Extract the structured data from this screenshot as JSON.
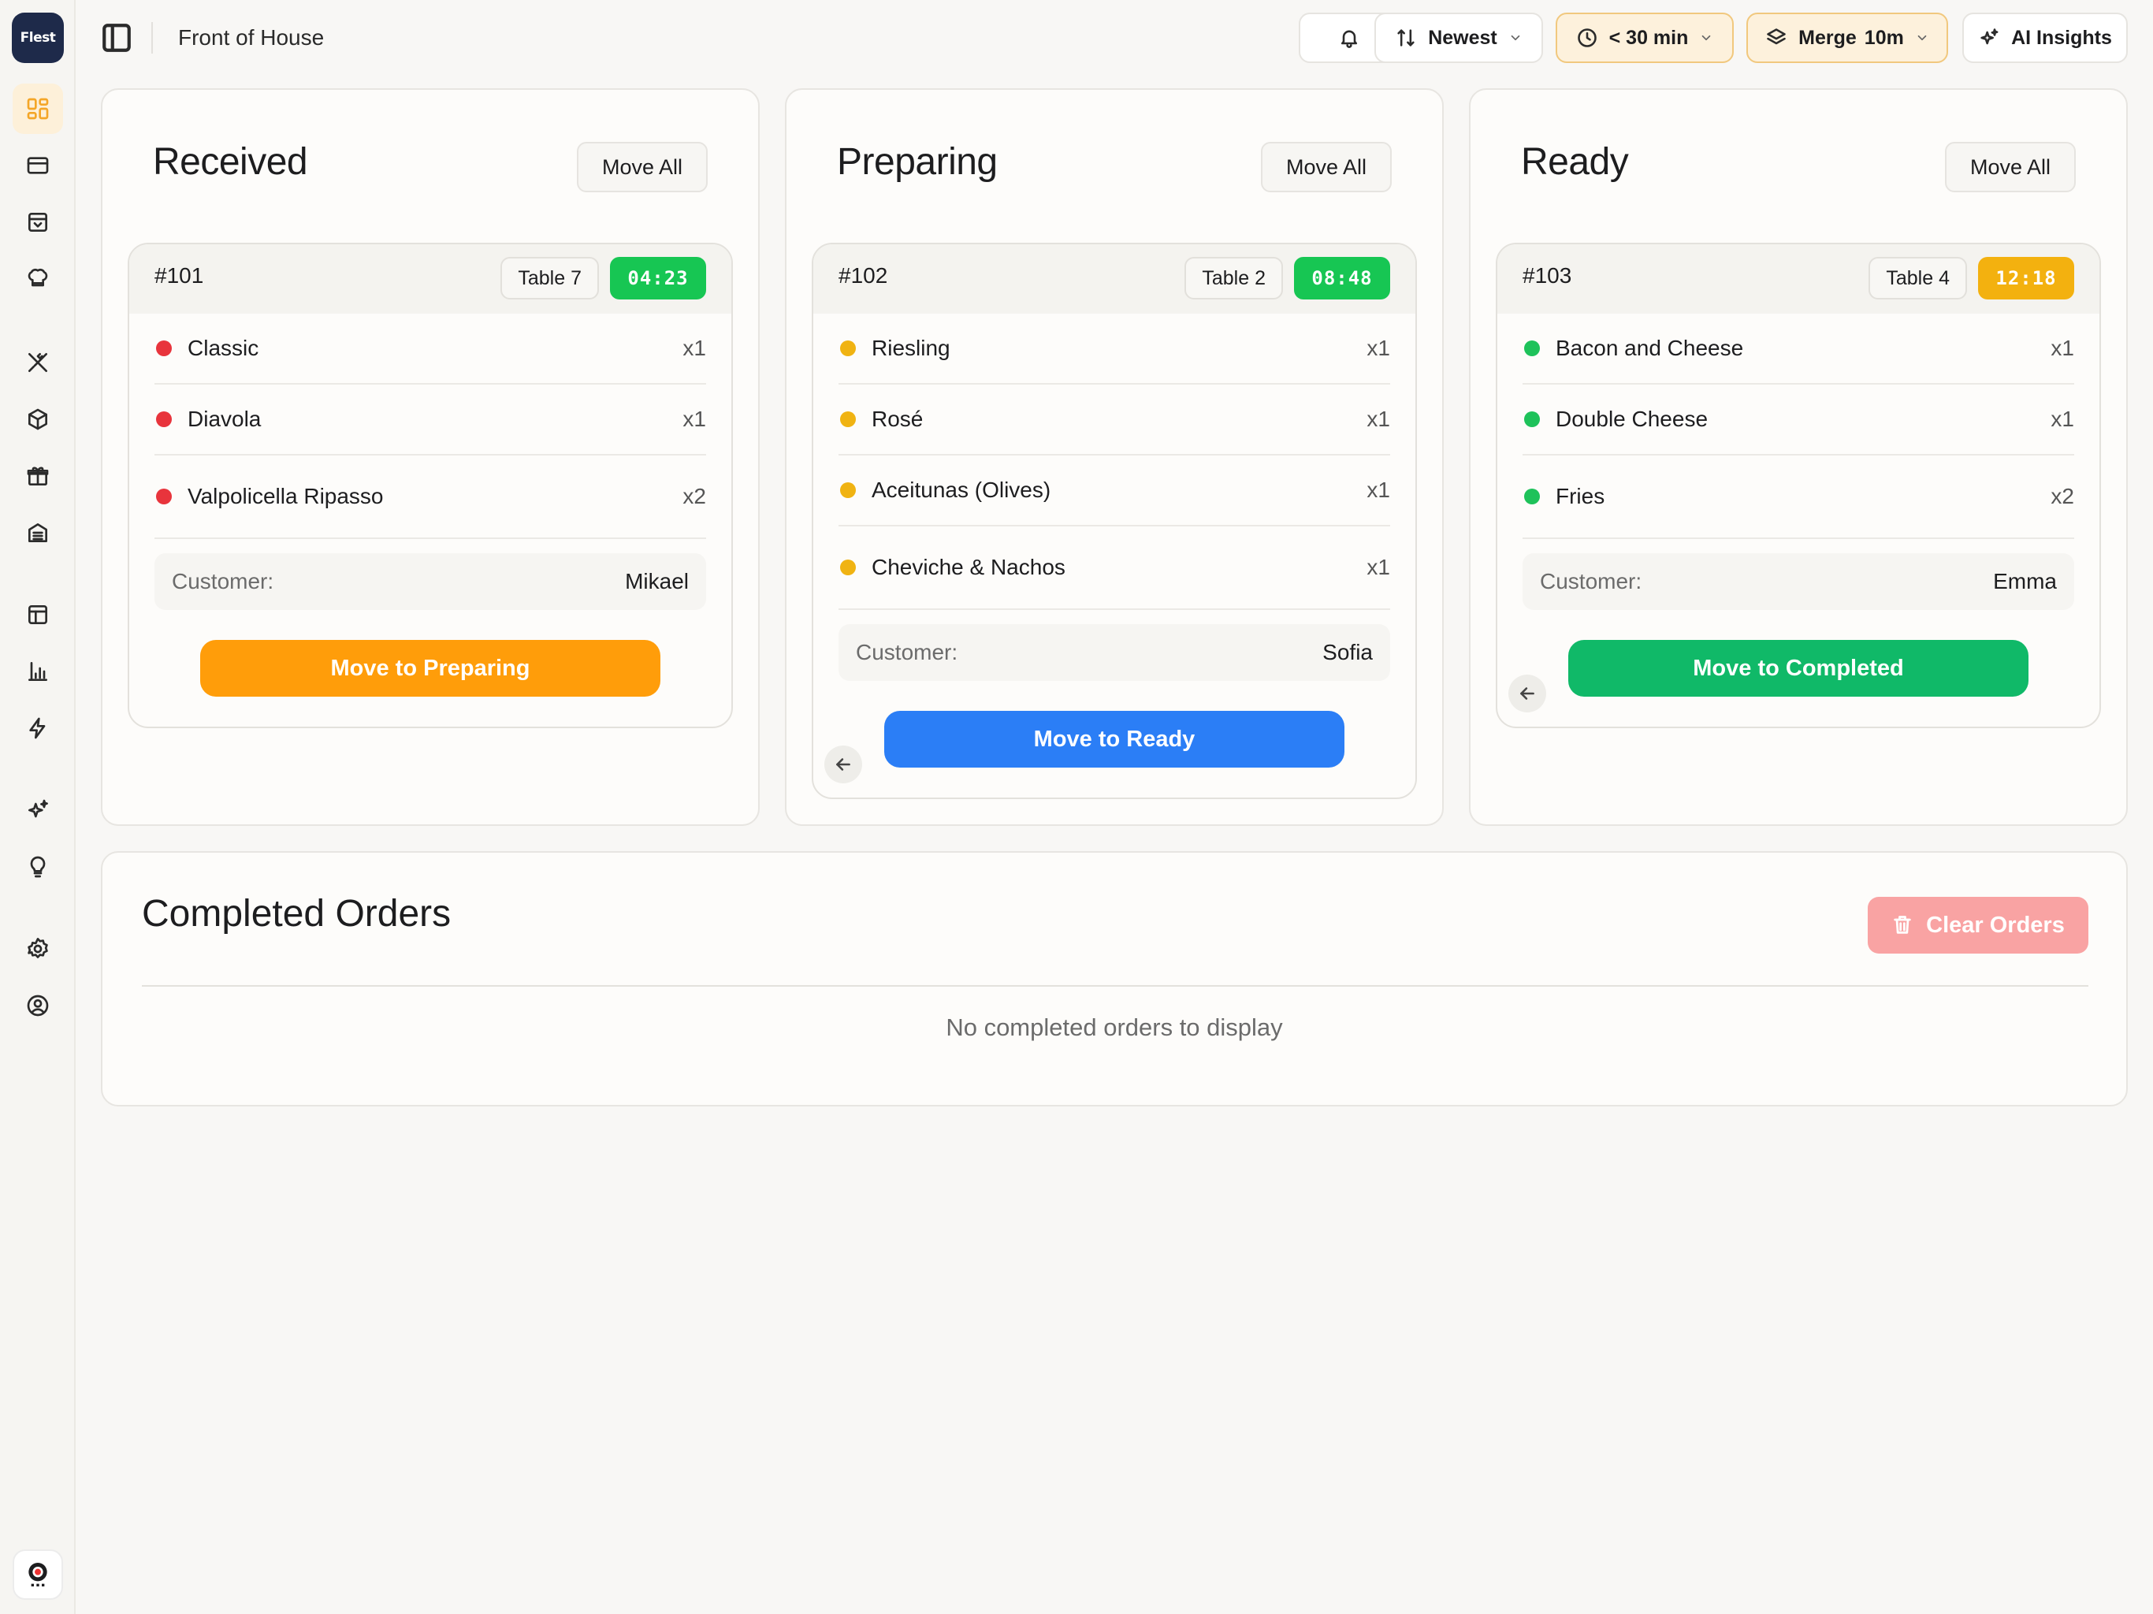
{
  "app": {
    "logo_text": "Flest",
    "page_title": "Front of House"
  },
  "sidebar": {
    "icons": [
      "dashboard-icon",
      "card-icon",
      "inbox-icon",
      "chef-hat-icon",
      "utensils-icon",
      "package-icon",
      "gift-icon",
      "register-icon",
      "layout-icon",
      "bar-chart-icon",
      "bolt-icon",
      "sparkles-icon",
      "lightbulb-icon",
      "settings-icon",
      "user-circle-icon"
    ],
    "active": "dashboard-icon"
  },
  "toolbar": {
    "notifications_icon": "bell-icon",
    "sort_label": "Newest",
    "time_filter_label": "< 30 min",
    "merge_label": "Merge",
    "merge_value": "10m",
    "insights_label": "AI Insights"
  },
  "colors": {
    "accent": "#f4a628",
    "red_dot": "#e8343c",
    "yellow_dot": "#f0b312",
    "green_dot": "#1ec25a",
    "timer_green": "#17c653",
    "timer_amber": "#f3b10f",
    "preparing_btn": "#ff9d0a",
    "ready_btn": "#2b7ef6",
    "completed_btn": "#10b968",
    "clear_btn": "#f9a3a3"
  },
  "columns": [
    {
      "title": "Received",
      "move_all": "Move All",
      "order": {
        "id": "#101",
        "table": "Table 7",
        "timer": "04:23",
        "items": [
          {
            "name": "Classic",
            "qty": "x1"
          },
          {
            "name": "Diavola",
            "qty": "x1"
          },
          {
            "name": "Valpolicella Ripasso",
            "qty": "x2"
          }
        ],
        "customer_label": "Customer:",
        "customer": "Mikael",
        "action": "Move to Preparing"
      }
    },
    {
      "title": "Preparing",
      "move_all": "Move All",
      "order": {
        "id": "#102",
        "table": "Table 2",
        "timer": "08:48",
        "items": [
          {
            "name": "Riesling",
            "qty": "x1"
          },
          {
            "name": "Rosé",
            "qty": "x1"
          },
          {
            "name": "Aceitunas (Olives)",
            "qty": "x1"
          },
          {
            "name": "Cheviche & Nachos",
            "qty": "x1"
          }
        ],
        "customer_label": "Customer:",
        "customer": "Sofia",
        "action": "Move to Ready"
      }
    },
    {
      "title": "Ready",
      "move_all": "Move All",
      "order": {
        "id": "#103",
        "table": "Table 4",
        "timer": "12:18",
        "items": [
          {
            "name": "Bacon and Cheese",
            "qty": "x1"
          },
          {
            "name": "Double Cheese",
            "qty": "x1"
          },
          {
            "name": "Fries",
            "qty": "x2"
          }
        ],
        "customer_label": "Customer:",
        "customer": "Emma",
        "action": "Move to Completed"
      }
    }
  ],
  "completed": {
    "title": "Completed Orders",
    "clear_label": "Clear Orders",
    "empty_message": "No completed orders to display"
  }
}
